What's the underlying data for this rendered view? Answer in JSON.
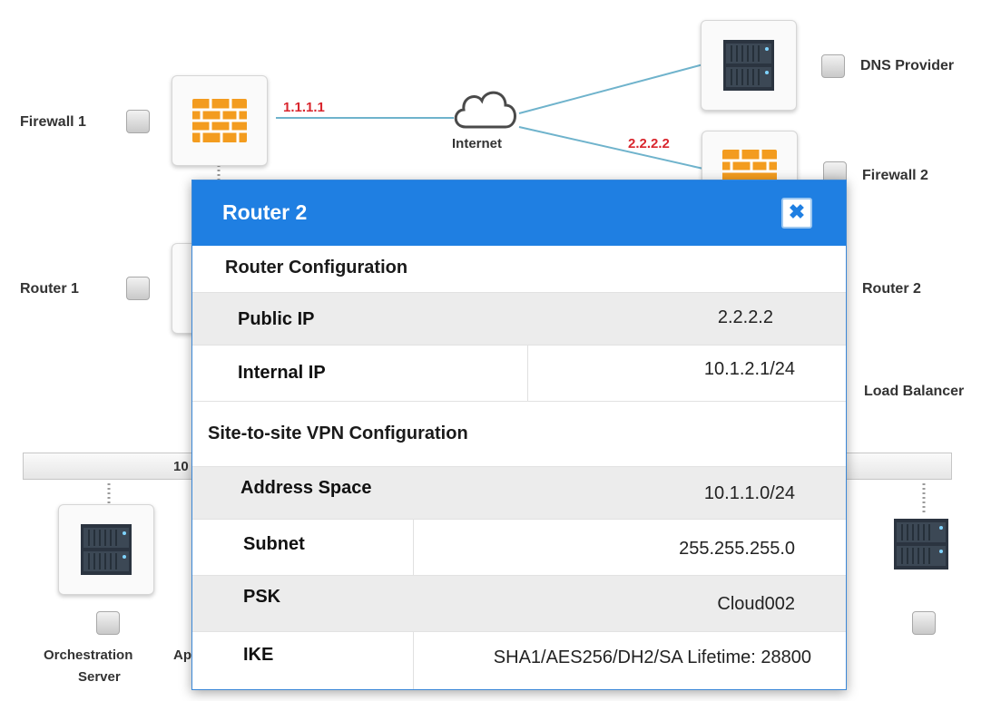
{
  "topology": {
    "firewall1": {
      "label": "Firewall 1",
      "ip": "1.1.1.1"
    },
    "internet": {
      "label": "Internet"
    },
    "dns_provider": {
      "label": "DNS Provider"
    },
    "firewall2": {
      "label": "Firewall 2",
      "ip": "2.2.2.2"
    },
    "router1": {
      "label": "Router 1"
    },
    "router2": {
      "label": "Router 2"
    },
    "load_balancer": {
      "label": "Load Balancer"
    },
    "switch_partial_label": "10",
    "orchestration_server": {
      "label_line1": "Orchestration",
      "label_line2": "Server"
    },
    "partial_label": "Ap"
  },
  "modal": {
    "title": "Router 2",
    "close_icon": "close-icon",
    "router_config": {
      "heading": "Router Configuration",
      "rows": [
        {
          "key": "Public IP",
          "value": "2.2.2.2"
        },
        {
          "key": "Internal IP",
          "value": "10.1.2.1/24"
        }
      ]
    },
    "vpn_config": {
      "heading": "Site-to-site VPN Configuration",
      "rows": [
        {
          "key": "Address Space",
          "value": "10.1.1.0/24"
        },
        {
          "key": "Subnet",
          "value": "255.255.255.0"
        },
        {
          "key": "PSK",
          "value": "Cloud002"
        },
        {
          "key": "IKE",
          "value": "SHA1/AES256/DH2/SA Lifetime: 28800"
        }
      ]
    }
  },
  "colors": {
    "modal_header": "#1f7fe2",
    "link_line": "#6fb3cc",
    "ip_label": "#d9262e",
    "firewall_orange": "#f39c1f"
  }
}
